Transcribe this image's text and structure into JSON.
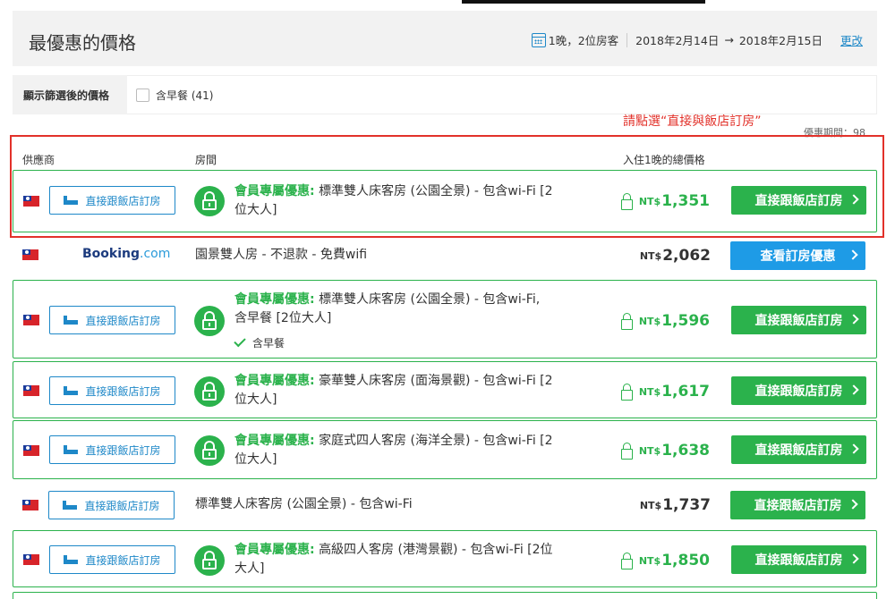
{
  "header": {
    "title": "最優惠的價格",
    "nights_guests": "1晚，2位房客",
    "checkin": "2018年2月14日",
    "arrow": "→",
    "checkout": "2018年2月15日",
    "edit_label": "更改"
  },
  "filter": {
    "label": "顯示篩選後的價格",
    "breakfast_option": "含早餐 (41)"
  },
  "annotation": "請點選“直接與飯店訂房”",
  "deal_period": "優惠期間：98",
  "columns": {
    "provider": "供應商",
    "room": "房間",
    "price": "入住1晚的總價格"
  },
  "listings": [
    {
      "provider": "直接跟飯店訂房",
      "member_label": "會員專屬優惠:",
      "room_line1": "標準雙人床客房 (公園全景) - 包含wi-Fi [2",
      "room_line2": "位大人]",
      "currency": "NT$",
      "price": "1,351",
      "cta": "直接跟飯店訂房"
    },
    {
      "provider": "Booking",
      "provider_suffix": ".com",
      "room": "園景雙人房 - 不退款 - 免費wifi",
      "currency": "NT$",
      "price": "2,062",
      "cta": "查看訂房優惠"
    },
    {
      "provider": "直接跟飯店訂房",
      "member_label": "會員專屬優惠:",
      "room_line1": "標準雙人床客房 (公園全景) - 包含wi-Fi,",
      "room_line2": "含早餐 [2位大人]",
      "extra": "含早餐",
      "currency": "NT$",
      "price": "1,596",
      "cta": "直接跟飯店訂房"
    },
    {
      "provider": "直接跟飯店訂房",
      "member_label": "會員專屬優惠:",
      "room_line1": "豪華雙人床客房 (面海景觀) - 包含wi-Fi [2",
      "room_line2": "位大人]",
      "currency": "NT$",
      "price": "1,617",
      "cta": "直接跟飯店訂房"
    },
    {
      "provider": "直接跟飯店訂房",
      "member_label": "會員專屬優惠:",
      "room_line1": "家庭式四人客房 (海洋全景) - 包含wi-Fi [2",
      "room_line2": "位大人]",
      "currency": "NT$",
      "price": "1,638",
      "cta": "直接跟飯店訂房"
    },
    {
      "provider": "直接跟飯店訂房",
      "room": "標準雙人床客房 (公園全景) - 包含wi-Fi",
      "currency": "NT$",
      "price": "1,737",
      "cta": "直接跟飯店訂房"
    },
    {
      "provider": "直接跟飯店訂房",
      "member_label": "會員專屬優惠:",
      "room_line1": "高級四人客房 (港灣景觀) - 包含wi-Fi [2位",
      "room_line2": "大人]",
      "currency": "NT$",
      "price": "1,850",
      "cta": "直接跟飯店訂房"
    }
  ],
  "colors": {
    "green": "#2bb24c",
    "blue": "#1e88c8",
    "cta_blue": "#1e9be6",
    "annotation_red": "#e2312a"
  }
}
